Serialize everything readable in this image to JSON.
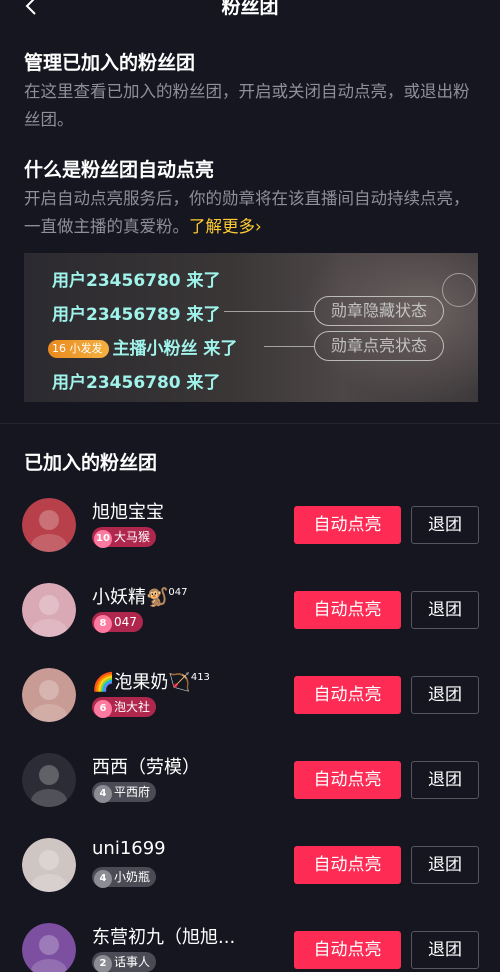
{
  "nav": {
    "title": "粉丝团"
  },
  "manage": {
    "title": "管理已加入的粉丝团",
    "desc": "在这里查看已加入的粉丝团，开启或关闭自动点亮，或退出粉丝团。"
  },
  "what": {
    "title": "什么是粉丝团自动点亮",
    "desc": "开启自动点亮服务后，你的勋章将在该直播间自动持续点亮，一直做主播的真爱粉。",
    "learn_more": "了解更多›"
  },
  "demo": {
    "row1": "用户23456780 来了",
    "row2": "用户23456789 来了",
    "badge_level": "16",
    "badge_name": "小发发",
    "row3": "主播小粉丝 来了",
    "row4": "用户23456780 来了",
    "pill_hidden": "勋章隐藏状态",
    "pill_lit": "勋章点亮状态"
  },
  "list": {
    "title": "已加入的粉丝团",
    "light_label": "自动点亮",
    "quit_label": "退团",
    "items": [
      {
        "name": "旭旭宝宝",
        "sup": "",
        "level": "10",
        "badge": "大马猴",
        "style": "pink",
        "avatar_color": "#b8404a"
      },
      {
        "name": "小妖精🐒",
        "sup": "047",
        "level": "8",
        "badge": "047",
        "style": "pink",
        "avatar_color": "#d9a9b6"
      },
      {
        "name": "🌈泡果奶🏹",
        "sup": "413",
        "level": "6",
        "badge": "泡大社",
        "style": "pink",
        "avatar_color": "#c89b95"
      },
      {
        "name": "西西（劳模）",
        "sup": "",
        "level": "4",
        "badge": "平西府",
        "style": "gray",
        "avatar_color": "#2b2c35"
      },
      {
        "name": "uni1699",
        "sup": "",
        "level": "4",
        "badge": "小奶瓶",
        "style": "gray",
        "avatar_color": "#cfc6c4"
      },
      {
        "name": "东营初九（旭旭...",
        "sup": "",
        "level": "2",
        "badge": "话事人",
        "style": "gray",
        "avatar_color": "#7c4fa0"
      }
    ]
  },
  "colors": {
    "accent": "#fe2c55",
    "link": "#ffcc33",
    "background": "#15161f"
  }
}
